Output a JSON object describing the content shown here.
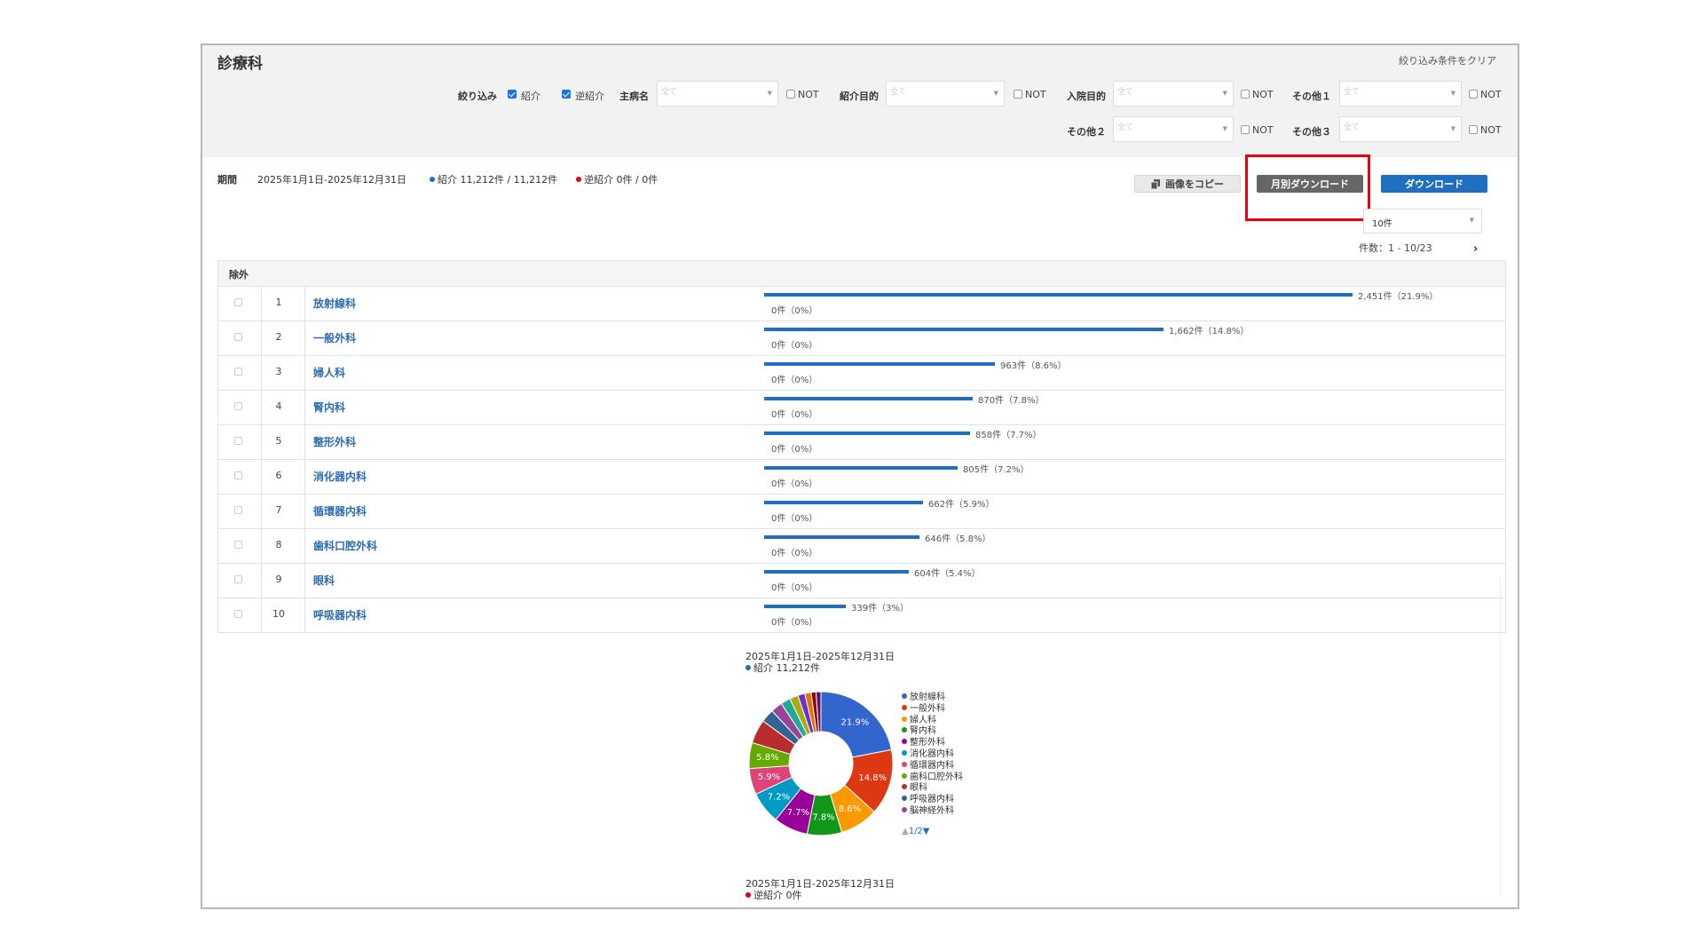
{
  "header": {
    "title": "診療科",
    "clear_filters": "絞り込み条件をクリア",
    "filter_label": "絞り込み",
    "referral_label": "紹介",
    "reverse_referral_label": "逆紹介",
    "not_label": "NOT",
    "select_placeholder": "全て",
    "filters": {
      "main_disease": "主病名",
      "referral_purpose": "紹介目的",
      "admission_purpose": "入院目的",
      "other1": "その他１",
      "other2": "その他２",
      "other3": "その他３"
    }
  },
  "summary": {
    "period_label": "期間",
    "period_value": "2025年1月1日-2025年12月31日",
    "referral_summary": "紹介 11,212件 / 11,212件",
    "reverse_summary": "逆紹介 0件 / 0件",
    "referral_color": "#1f6fc1",
    "reverse_color": "#e60012"
  },
  "toolbar": {
    "copy_image": "画像をコピー",
    "copy_icon": "copy-icon",
    "monthly_download": "月別ダウンロード",
    "download": "ダウンロード",
    "per_page": "10件",
    "count": "件数：1 - 10/23",
    "next": "›"
  },
  "table": {
    "header_exclude": "除外",
    "rows": [
      {
        "idx": "1",
        "name": "放射線科",
        "label": "2,451件（21.9%）",
        "value": 2451,
        "zero": "0件（0%）"
      },
      {
        "idx": "2",
        "name": "一般外科",
        "label": "1,662件（14.8%）",
        "value": 1662,
        "zero": "0件（0%）"
      },
      {
        "idx": "3",
        "name": "婦人科",
        "label": "963件（8.6%）",
        "value": 963,
        "zero": "0件（0%）"
      },
      {
        "idx": "4",
        "name": "腎内科",
        "label": "870件（7.8%）",
        "value": 870,
        "zero": "0件（0%）"
      },
      {
        "idx": "5",
        "name": "整形外科",
        "label": "858件（7.7%）",
        "value": 858,
        "zero": "0件（0%）"
      },
      {
        "idx": "6",
        "name": "消化器内科",
        "label": "805件（7.2%）",
        "value": 805,
        "zero": "0件（0%）"
      },
      {
        "idx": "7",
        "name": "循環器内科",
        "label": "662件（5.9%）",
        "value": 662,
        "zero": "0件（0%）"
      },
      {
        "idx": "8",
        "name": "歯科口腔外科",
        "label": "646件（5.8%）",
        "value": 646,
        "zero": "0件（0%）"
      },
      {
        "idx": "9",
        "name": "眼科",
        "label": "604件（5.4%）",
        "value": 604,
        "zero": "0件（0%）"
      },
      {
        "idx": "10",
        "name": "呼吸器内科",
        "label": "339件（3%）",
        "value": 339,
        "zero": "0件（0%）"
      }
    ]
  },
  "chart_data": {
    "type": "pie",
    "title": "2025年1月1日-2025年12月31日",
    "subtitle": "紹介 11,212件",
    "legend_position": "right",
    "slices": [
      {
        "name": "放射線科",
        "value": 21.9,
        "label": "21.9%",
        "color": "#3366cc"
      },
      {
        "name": "一般外科",
        "value": 14.8,
        "label": "14.8%",
        "color": "#dc3912"
      },
      {
        "name": "婦人科",
        "value": 8.6,
        "label": "8.6%",
        "color": "#ff9900"
      },
      {
        "name": "腎内科",
        "value": 7.8,
        "label": "7.8%",
        "color": "#109618"
      },
      {
        "name": "整形外科",
        "value": 7.7,
        "label": "7.7%",
        "color": "#990099"
      },
      {
        "name": "消化器内科",
        "value": 7.2,
        "label": "7.2%",
        "color": "#0099c6"
      },
      {
        "name": "循環器内科",
        "value": 5.9,
        "label": "5.9%",
        "color": "#dd4477"
      },
      {
        "name": "歯科口腔外科",
        "value": 5.8,
        "label": "5.8%",
        "color": "#66aa00"
      },
      {
        "name": "眼科",
        "value": 5.4,
        "label": "",
        "color": "#b82e2e"
      },
      {
        "name": "呼吸器内科",
        "value": 3.0,
        "label": "",
        "color": "#316395"
      },
      {
        "name": "脳神経外科",
        "value": 2.6,
        "label": "",
        "color": "#994499"
      },
      {
        "name": "",
        "value": 2.2,
        "label": "",
        "color": "#22aa99"
      },
      {
        "name": "",
        "value": 1.9,
        "label": "",
        "color": "#aaaa11"
      },
      {
        "name": "",
        "value": 1.6,
        "label": "",
        "color": "#6633cc"
      },
      {
        "name": "",
        "value": 1.4,
        "label": "",
        "color": "#e67300"
      },
      {
        "name": "",
        "value": 1.1,
        "label": "",
        "color": "#8b0707"
      },
      {
        "name": "",
        "value": 1.1,
        "label": "",
        "color": "#651067"
      }
    ],
    "legend_pager": "1/2"
  },
  "second_chart": {
    "title": "2025年1月1日-2025年12月31日",
    "subtitle": "逆紹介 0件"
  }
}
